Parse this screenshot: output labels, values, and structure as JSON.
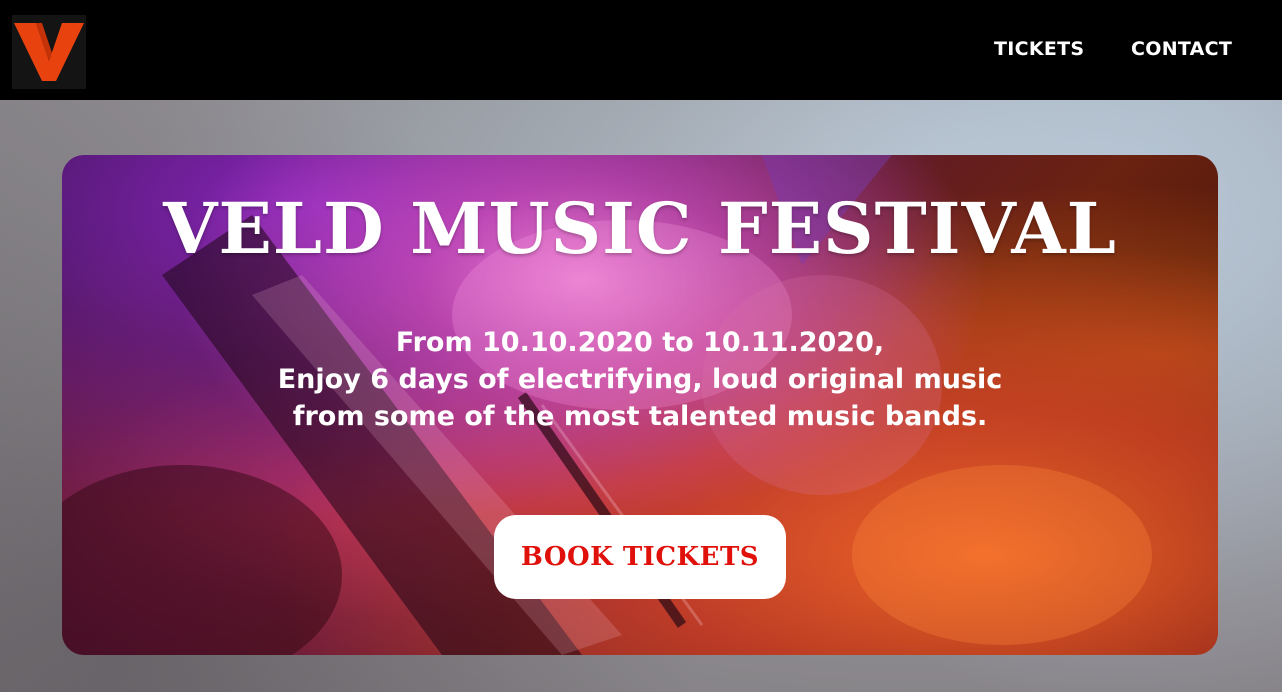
{
  "brand": {
    "logo_icon": "v-logo-icon",
    "logo_color": "#e8420f"
  },
  "nav": {
    "links": [
      {
        "label": "TICKETS"
      },
      {
        "label": "CONTACT"
      }
    ]
  },
  "hero": {
    "title": "VELD MUSIC FESTIVAL",
    "lines": [
      "From 10.10.2020 to 10.11.2020,",
      "Enjoy 6 days of electrifying, loud original music",
      "from some of the most talented music bands."
    ],
    "cta_label": "BOOK TICKETS",
    "cta_color": "#e0110b"
  }
}
